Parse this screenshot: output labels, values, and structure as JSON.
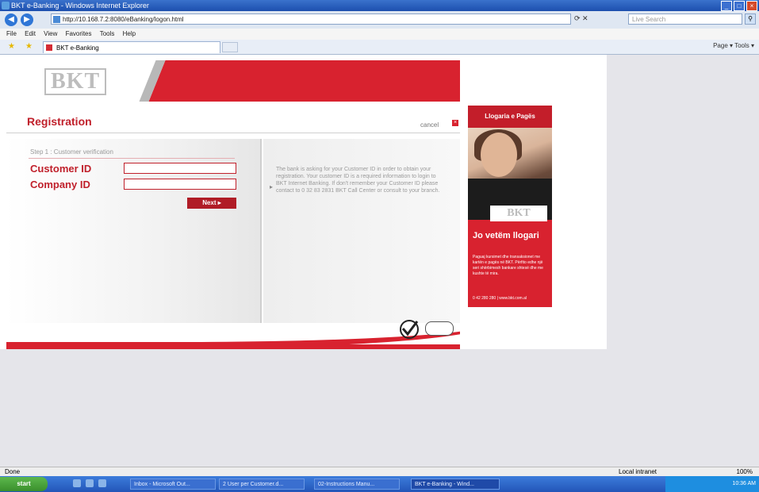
{
  "browser": {
    "window_title": "BKT e-Banking - Windows Internet Explorer",
    "address": "http://10.168.7.2:8080/eBanking/logon.html",
    "search_placeholder": "Live Search",
    "menu": [
      "File",
      "Edit",
      "View",
      "Favorites",
      "Tools",
      "Help"
    ],
    "tab_label": "BKT e-Banking",
    "cmdbar": "Page ▾  Tools ▾",
    "status_left": "Done",
    "status_zone": "Local intranet",
    "zoom": "100%"
  },
  "page": {
    "logo": "BKT",
    "title": "Registration",
    "cancel": "cancel",
    "step": "Step 1 : Customer verification",
    "customer_id_label": "Customer ID",
    "company_id_label": "Company ID",
    "customer_id_value": "",
    "company_id_value": "",
    "next": "Next ▸",
    "help": "The bank is asking for your Customer ID in order to obtain your registration. Your customer ID is a required information to login to BKT Internet Banking. If don't remember your Customer ID please contact to 0 32 83 2831 BKT Call Center or consult to your branch."
  },
  "ad": {
    "top": "Llogaria e Pagës",
    "logo": "BKT",
    "headline": "Jo vetëm llogari",
    "body": "Paguaj kursimet dhe transaksionet me kartën e pagës në BKT. Përfito edhe një seri shërbimesh bankare shtesë dhe me kushte të mira.",
    "footer": "0 42 280 280 | www.bkt.com.al"
  },
  "taskbar": {
    "start": "start",
    "items": [
      "Inbox - Microsoft Out...",
      "2 User per Customer.d...",
      "02-Instructions Manu...",
      "BKT e-Banking - Wind..."
    ],
    "clock": "10:36 AM"
  },
  "colors": {
    "brand_red": "#d8222f",
    "label_red": "#c0202b"
  }
}
